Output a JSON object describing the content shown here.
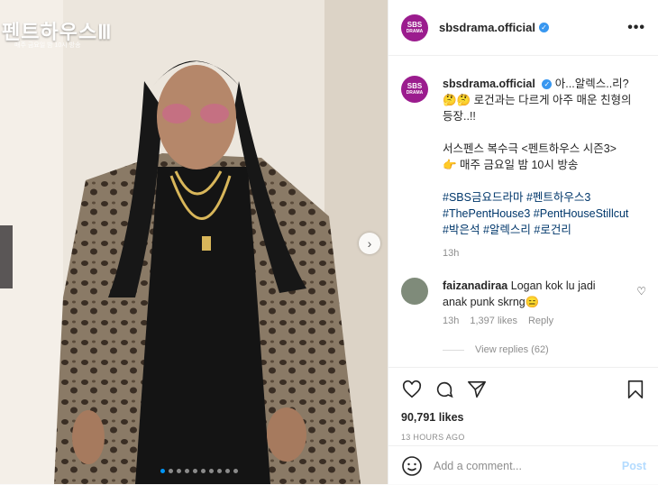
{
  "media": {
    "overlay_title": "펜트하우스Ⅲ",
    "overlay_sub": "매주 금요일 밤 10시 방송",
    "carousel_total": 10,
    "carousel_active": 0
  },
  "header": {
    "avatar_line1": "SBS",
    "avatar_line2": "DRAMA",
    "username": "sbsdrama.official",
    "verified_mark": "✓",
    "more": "•••"
  },
  "caption": {
    "username": "sbsdrama.official",
    "text_line": "아...알렉스..리?🤔🤔 로건과는 다르게 아주 매운 친형의 등장..!!",
    "promo1": "서스펜스 복수극 <펜트하우스 시즌3>",
    "promo2": "👉 매주 금요일 밤 10시 방송",
    "tags": [
      "#SBS금요드라마",
      "#펜트하우스3",
      "#ThePentHouse3",
      "#PentHouseStillcut",
      "#박은석",
      "#알렉스리",
      "#로건리"
    ],
    "time": "13h"
  },
  "comment": {
    "username": "faizanadiraa",
    "text": "Logan kok lu jadi anak punk skrng😑",
    "time": "13h",
    "likes": "1,397 likes",
    "reply": "Reply",
    "view_replies": "View replies (62)"
  },
  "actions": {
    "likes": "90,791 likes",
    "timestamp": "13 HOURS AGO",
    "comment_placeholder": "Add a comment...",
    "post_label": "Post"
  },
  "colors": {
    "accent": "#0095f6",
    "link": "#00376b",
    "brand_avatar": "#9b1c8e",
    "muted": "#8e8e8e"
  }
}
